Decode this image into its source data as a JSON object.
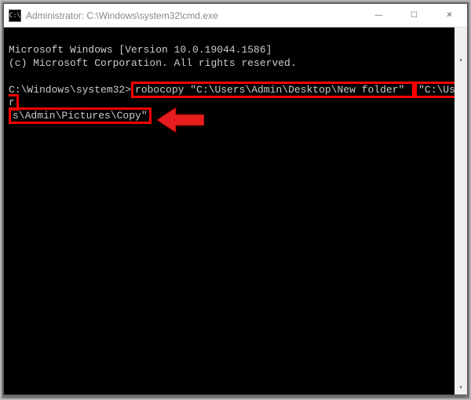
{
  "titlebar": {
    "icon_text": "C:\\",
    "title": "Administrator: C:\\Windows\\system32\\cmd.exe"
  },
  "controls": {
    "minimize": "—",
    "maximize": "☐",
    "close": "✕"
  },
  "terminal": {
    "line1": "Microsoft Windows [Version 10.0.19044.1586]",
    "line2": "(c) Microsoft Corporation. All rights reserved.",
    "prompt_pre": "C:\\Windows\\system32>",
    "cmd_part1": "robocopy \"C:\\Users\\Admin\\Desktop\\New folder\" ",
    "cmd_hl2a": "\"C:\\User",
    "cmd_hl2b": "s\\Admin\\Pictures\\Copy\""
  },
  "scrollbar": {
    "up": "▴",
    "down": "▾"
  },
  "colors": {
    "highlight": "#ff0000",
    "arrow": "#e81e1e",
    "terminal_bg": "#000000",
    "terminal_fg": "#cccccc"
  }
}
